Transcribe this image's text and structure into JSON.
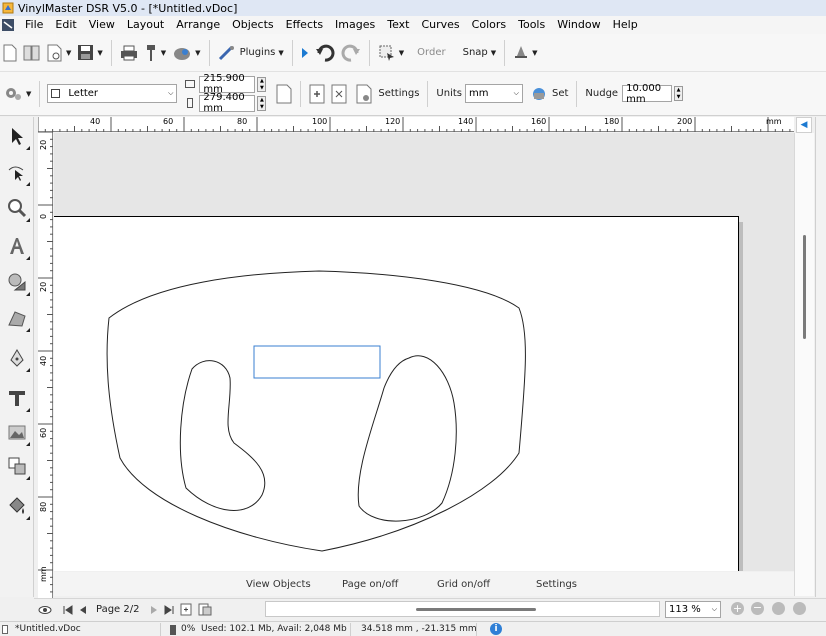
{
  "window": {
    "title": "VinylMaster DSR V5.0 - [*Untitled.vDoc]"
  },
  "menu": [
    "File",
    "Edit",
    "View",
    "Layout",
    "Arrange",
    "Objects",
    "Effects",
    "Images",
    "Text",
    "Curves",
    "Colors",
    "Tools",
    "Window",
    "Help"
  ],
  "toolbar": {
    "plugins_label": "Plugins",
    "order_label": "Order",
    "snap_label": "Snap"
  },
  "property_bar": {
    "page_size": "Letter",
    "width": "215.900 mm",
    "height": "279.400 mm",
    "settings_label": "Settings",
    "units_label": "Units",
    "units_value": "mm",
    "set_label": "Set",
    "nudge_label": "Nudge",
    "nudge_value": "10.000 mm"
  },
  "rulers": {
    "horizontal": [
      "40",
      "60",
      "80",
      "100",
      "120",
      "140",
      "160",
      "180",
      "200",
      "mm"
    ],
    "vertical": [
      "20",
      "0",
      "20",
      "40",
      "60",
      "80",
      "mm"
    ]
  },
  "canvas_links": [
    "View Objects",
    "Page on/off",
    "Grid on/off",
    "Settings"
  ],
  "navigator": {
    "page_label": "Page 2/2",
    "zoom": "113 %"
  },
  "status": {
    "filename": "*Untitled.vDoc",
    "progress": "0%",
    "memory": "Used: 102.1 Mb, Avail: 2,048 Mb",
    "coords": "34.518 mm , -21.315 mm"
  },
  "colors": {
    "accent": "#1c7ad1",
    "selection": "#3a7fd0"
  }
}
